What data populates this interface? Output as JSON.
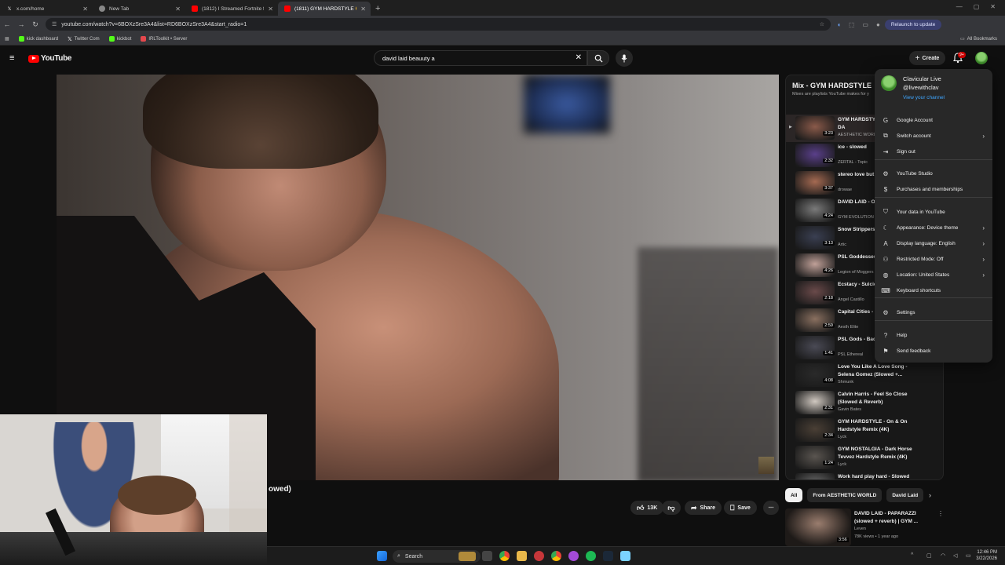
{
  "browser": {
    "tabs": [
      {
        "title": "x.com/home",
        "icon": "x-icon"
      },
      {
        "title": "New Tab",
        "icon": "chrome-icon"
      },
      {
        "title": "(1812) I Streamed Fortnite for",
        "icon": "youtube-icon"
      },
      {
        "title": "(1811) GYM HARDSTYLE 😮",
        "icon": "youtube-icon",
        "active": true
      }
    ],
    "url": "youtube.com/watch?v=6BOXzSre3A4&list=RD6BOXzSre3A4&start_radio=1",
    "relaunch_label": "Relaunch to update",
    "bookmarks": [
      {
        "label": "kick dashboard",
        "color": "#53fc18"
      },
      {
        "label": "Twitter Com",
        "color": "#ffffff"
      },
      {
        "label": "kickbot",
        "color": "#53fc18"
      },
      {
        "label": "IRLToolkit • Server",
        "color": "#e5484d"
      }
    ],
    "all_bookmarks_label": "All Bookmarks"
  },
  "youtube": {
    "logo_text": "YouTube",
    "search_value": "david laid beauuty a",
    "create_label": "Create",
    "notification_badge": "9+"
  },
  "video": {
    "title_fragment": "owed)",
    "likes": "13K",
    "share_label": "Share",
    "save_label": "Save"
  },
  "playlist": {
    "title": "Mix - GYM HARDSTYLE",
    "subtitle": "Mixes are playlists YouTube makes for y",
    "items": [
      {
        "title": "GYM HARDSTYLE 😮 And A Beat I DA",
        "channel": "AESTHETIC WORLD",
        "duration": "3:23",
        "current": true,
        "color": "#8a5a4a"
      },
      {
        "title": "ice - slowed",
        "channel": "ZERTAL - Topic",
        "duration": "2:32",
        "color": "#5a3f8a"
      },
      {
        "title": "stereo love but perfection",
        "channel": "drowae",
        "duration": "3:37",
        "color": "#a56a52"
      },
      {
        "title": "DAVID LAID - O MOTIVATION",
        "channel": "GYM EVOLUTION",
        "duration": "4:24",
        "color": "#7a7a7a"
      },
      {
        "title": "Snow Strippers (Slowed + impro",
        "channel": "Artic",
        "duration": "3:13",
        "color": "#3a3f52"
      },
      {
        "title": "PSL Goddesses (slowed-reverb)",
        "channel": "Legion of Moggers",
        "duration": "4:26",
        "color": "#c0a098"
      },
      {
        "title": "Ecstacy - Suicid + Reverb) [Musi",
        "channel": "Angel Castillo",
        "duration": "2:18",
        "color": "#6a4a4a"
      },
      {
        "title": "Capital Cities - (slowed + rever",
        "channel": "Aesth Elite",
        "duration": "2:59",
        "color": "#8a7060"
      },
      {
        "title": "PSL Gods - Bad (Slowed+Reverb",
        "channel": "PSL Ethereal",
        "duration": "1:41",
        "color": "#4a4a55"
      },
      {
        "title": "Love You Like A Love Song - Selena Gomez (Slowed +...",
        "channel": "Shmunk",
        "duration": "4:08",
        "color": "#2a2a2a"
      },
      {
        "title": "Calvin Harris - Feel So Close (Slowed & Reverb)",
        "channel": "Gavin Bates",
        "duration": "2:31",
        "color": "#d0c8c0"
      },
      {
        "title": "GYM HARDSTYLE - On & On Hardstyle Remix (4K)",
        "channel": "Lyck",
        "duration": "2:34",
        "color": "#4a3f35"
      },
      {
        "title": "GYM NOSTALGIA - Dark Horse Tevvez Hardstyle Remix (4K)",
        "channel": "Lyck",
        "duration": "1:24",
        "color": "#5a5550"
      },
      {
        "title": "Work hard play hard - Slowed",
        "channel": "",
        "duration": "",
        "color": "#6a6a6a"
      }
    ]
  },
  "chips": [
    "All",
    "From AESTHETIC WORLD",
    "David Laid"
  ],
  "recommendation": {
    "title": "DAVID LAID - PAPARAZZI (slowed + reverb) | GYM ...",
    "channel": "Leven",
    "meta": "78K views • 1 year ago",
    "duration": "3:56"
  },
  "account_menu": {
    "name": "Clavicular Live",
    "handle": "@livewithclav",
    "view_channel": "View your channel",
    "items": [
      {
        "label": "Google Account",
        "icon": "google-icon",
        "chevron": false
      },
      {
        "label": "Switch account",
        "icon": "switch-account-icon",
        "chevron": true
      },
      {
        "label": "Sign out",
        "icon": "sign-out-icon",
        "chevron": false
      },
      {
        "label": "YouTube Studio",
        "icon": "studio-icon",
        "chevron": false
      },
      {
        "label": "Purchases and memberships",
        "icon": "dollar-icon",
        "chevron": false
      },
      {
        "label": "Your data in YouTube",
        "icon": "shield-icon",
        "chevron": false
      },
      {
        "label": "Appearance: Device theme",
        "icon": "moon-icon",
        "chevron": true
      },
      {
        "label": "Display language: English",
        "icon": "translate-icon",
        "chevron": true
      },
      {
        "label": "Restricted Mode: Off",
        "icon": "restricted-icon",
        "chevron": true
      },
      {
        "label": "Location: United States",
        "icon": "globe-icon",
        "chevron": true
      },
      {
        "label": "Keyboard shortcuts",
        "icon": "keyboard-icon",
        "chevron": false
      },
      {
        "label": "Settings",
        "icon": "gear-icon",
        "chevron": false
      },
      {
        "label": "Help",
        "icon": "help-icon",
        "chevron": false
      },
      {
        "label": "Send feedback",
        "icon": "feedback-icon",
        "chevron": false
      }
    ]
  },
  "taskbar": {
    "search_label": "Search",
    "time": "12:46 PM",
    "date": "3/22/2026"
  }
}
